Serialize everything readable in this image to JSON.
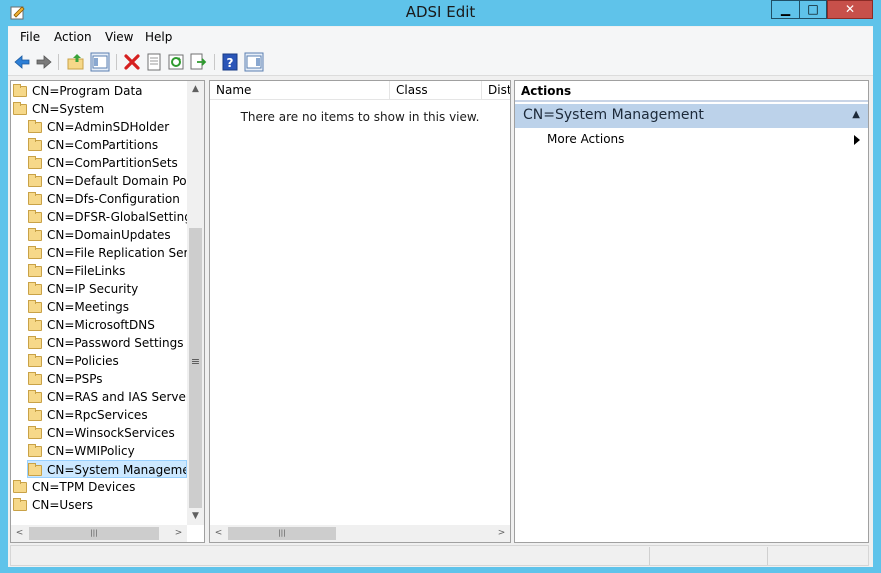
{
  "window": {
    "title": "ADSI Edit",
    "controls": {
      "minimize": "▁",
      "maximize": "□",
      "close": "✕"
    }
  },
  "menu": [
    "File",
    "Action",
    "View",
    "Help"
  ],
  "toolbar": {
    "buttons": [
      "back-icon",
      "forward-icon",
      "up-folder-icon",
      "show-hide-tree-icon",
      "delete-icon",
      "properties-icon",
      "refresh-icon",
      "export-list-icon",
      "help-icon",
      "show-hide-action-pane-icon"
    ]
  },
  "tree": {
    "items": [
      {
        "label": "CN=Program Data",
        "level": 0
      },
      {
        "label": "CN=System",
        "level": 0
      },
      {
        "label": "CN=AdminSDHolder",
        "level": 1
      },
      {
        "label": "CN=ComPartitions",
        "level": 1
      },
      {
        "label": "CN=ComPartitionSets",
        "level": 1
      },
      {
        "label": "CN=Default Domain Policy",
        "level": 1
      },
      {
        "label": "CN=Dfs-Configuration",
        "level": 1
      },
      {
        "label": "CN=DFSR-GlobalSettings",
        "level": 1
      },
      {
        "label": "CN=DomainUpdates",
        "level": 1
      },
      {
        "label": "CN=File Replication Service",
        "level": 1
      },
      {
        "label": "CN=FileLinks",
        "level": 1
      },
      {
        "label": "CN=IP Security",
        "level": 1
      },
      {
        "label": "CN=Meetings",
        "level": 1
      },
      {
        "label": "CN=MicrosoftDNS",
        "level": 1
      },
      {
        "label": "CN=Password Settings Container",
        "level": 1
      },
      {
        "label": "CN=Policies",
        "level": 1
      },
      {
        "label": "CN=PSPs",
        "level": 1
      },
      {
        "label": "CN=RAS and IAS Servers Access Check",
        "level": 1
      },
      {
        "label": "CN=RpcServices",
        "level": 1
      },
      {
        "label": "CN=WinsockServices",
        "level": 1
      },
      {
        "label": "CN=WMIPolicy",
        "level": 1
      },
      {
        "label": "CN=System Management",
        "level": 1,
        "selected": true
      },
      {
        "label": "CN=TPM Devices",
        "level": 0
      },
      {
        "label": "CN=Users",
        "level": 0
      }
    ]
  },
  "list": {
    "columns": [
      "Name",
      "Class",
      "Disti"
    ],
    "empty_message": "There are no items to show in this view."
  },
  "actions": {
    "header": "Actions",
    "section": "CN=System Management",
    "items": [
      {
        "label": "More Actions"
      }
    ]
  },
  "scroll_glyphs": {
    "up": "▲",
    "down": "▼",
    "left": "<",
    "right": ">",
    "grip": "|||",
    "vgrip": "≡"
  }
}
